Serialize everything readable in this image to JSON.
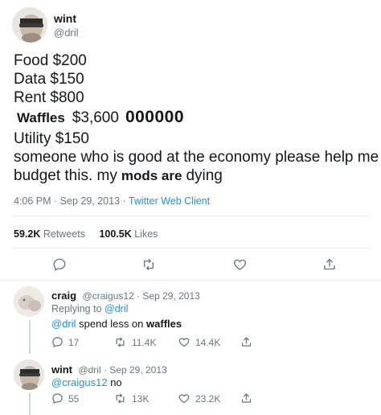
{
  "main_tweet": {
    "name": "wint",
    "handle": "@dril",
    "lines": {
      "food": "Food $200",
      "data": "Data $150",
      "rent": "Rent $800",
      "waffles_word": "Waffles",
      "waffles_price": "$3,600",
      "waffles_zeros": "000000",
      "utility": "Utility $150",
      "line6": "someone who is good at the economy please help me",
      "line7_start": "budget this. my",
      "line7_bold": "mods are",
      "line7_end": "dying"
    },
    "time": "4:06 PM · Sep 29, 2013 ·",
    "client": "Twitter Web Client",
    "retweets_count": "59.2K",
    "retweets_label": "Retweets",
    "likes_count": "100.5K",
    "likes_label": "Likes"
  },
  "icons": {
    "reply": "reply-icon",
    "retweet": "retweet-icon",
    "like": "heart-icon",
    "share": "share-icon"
  },
  "reply1": {
    "name": "craig",
    "handle_date": "@craigus12 · Sep 29, 2013",
    "replying_label": "Replying to",
    "replying_handle": "@dril",
    "mention": "@dril",
    "text": "spend less on",
    "bold_word": "waffles",
    "reply_count": "17",
    "retweet_count": "11.4K",
    "like_count": "14.4K"
  },
  "reply2": {
    "name": "wint",
    "handle_date": "@dril · Sep 29, 2013",
    "mention": "@craigus12",
    "text": "no",
    "reply_count": "55",
    "retweet_count": "13K",
    "like_count": "23.2K"
  },
  "colors": {
    "text": "#14171a",
    "muted": "#657786",
    "link": "#1b95e0",
    "divider": "#e6ecf0"
  }
}
